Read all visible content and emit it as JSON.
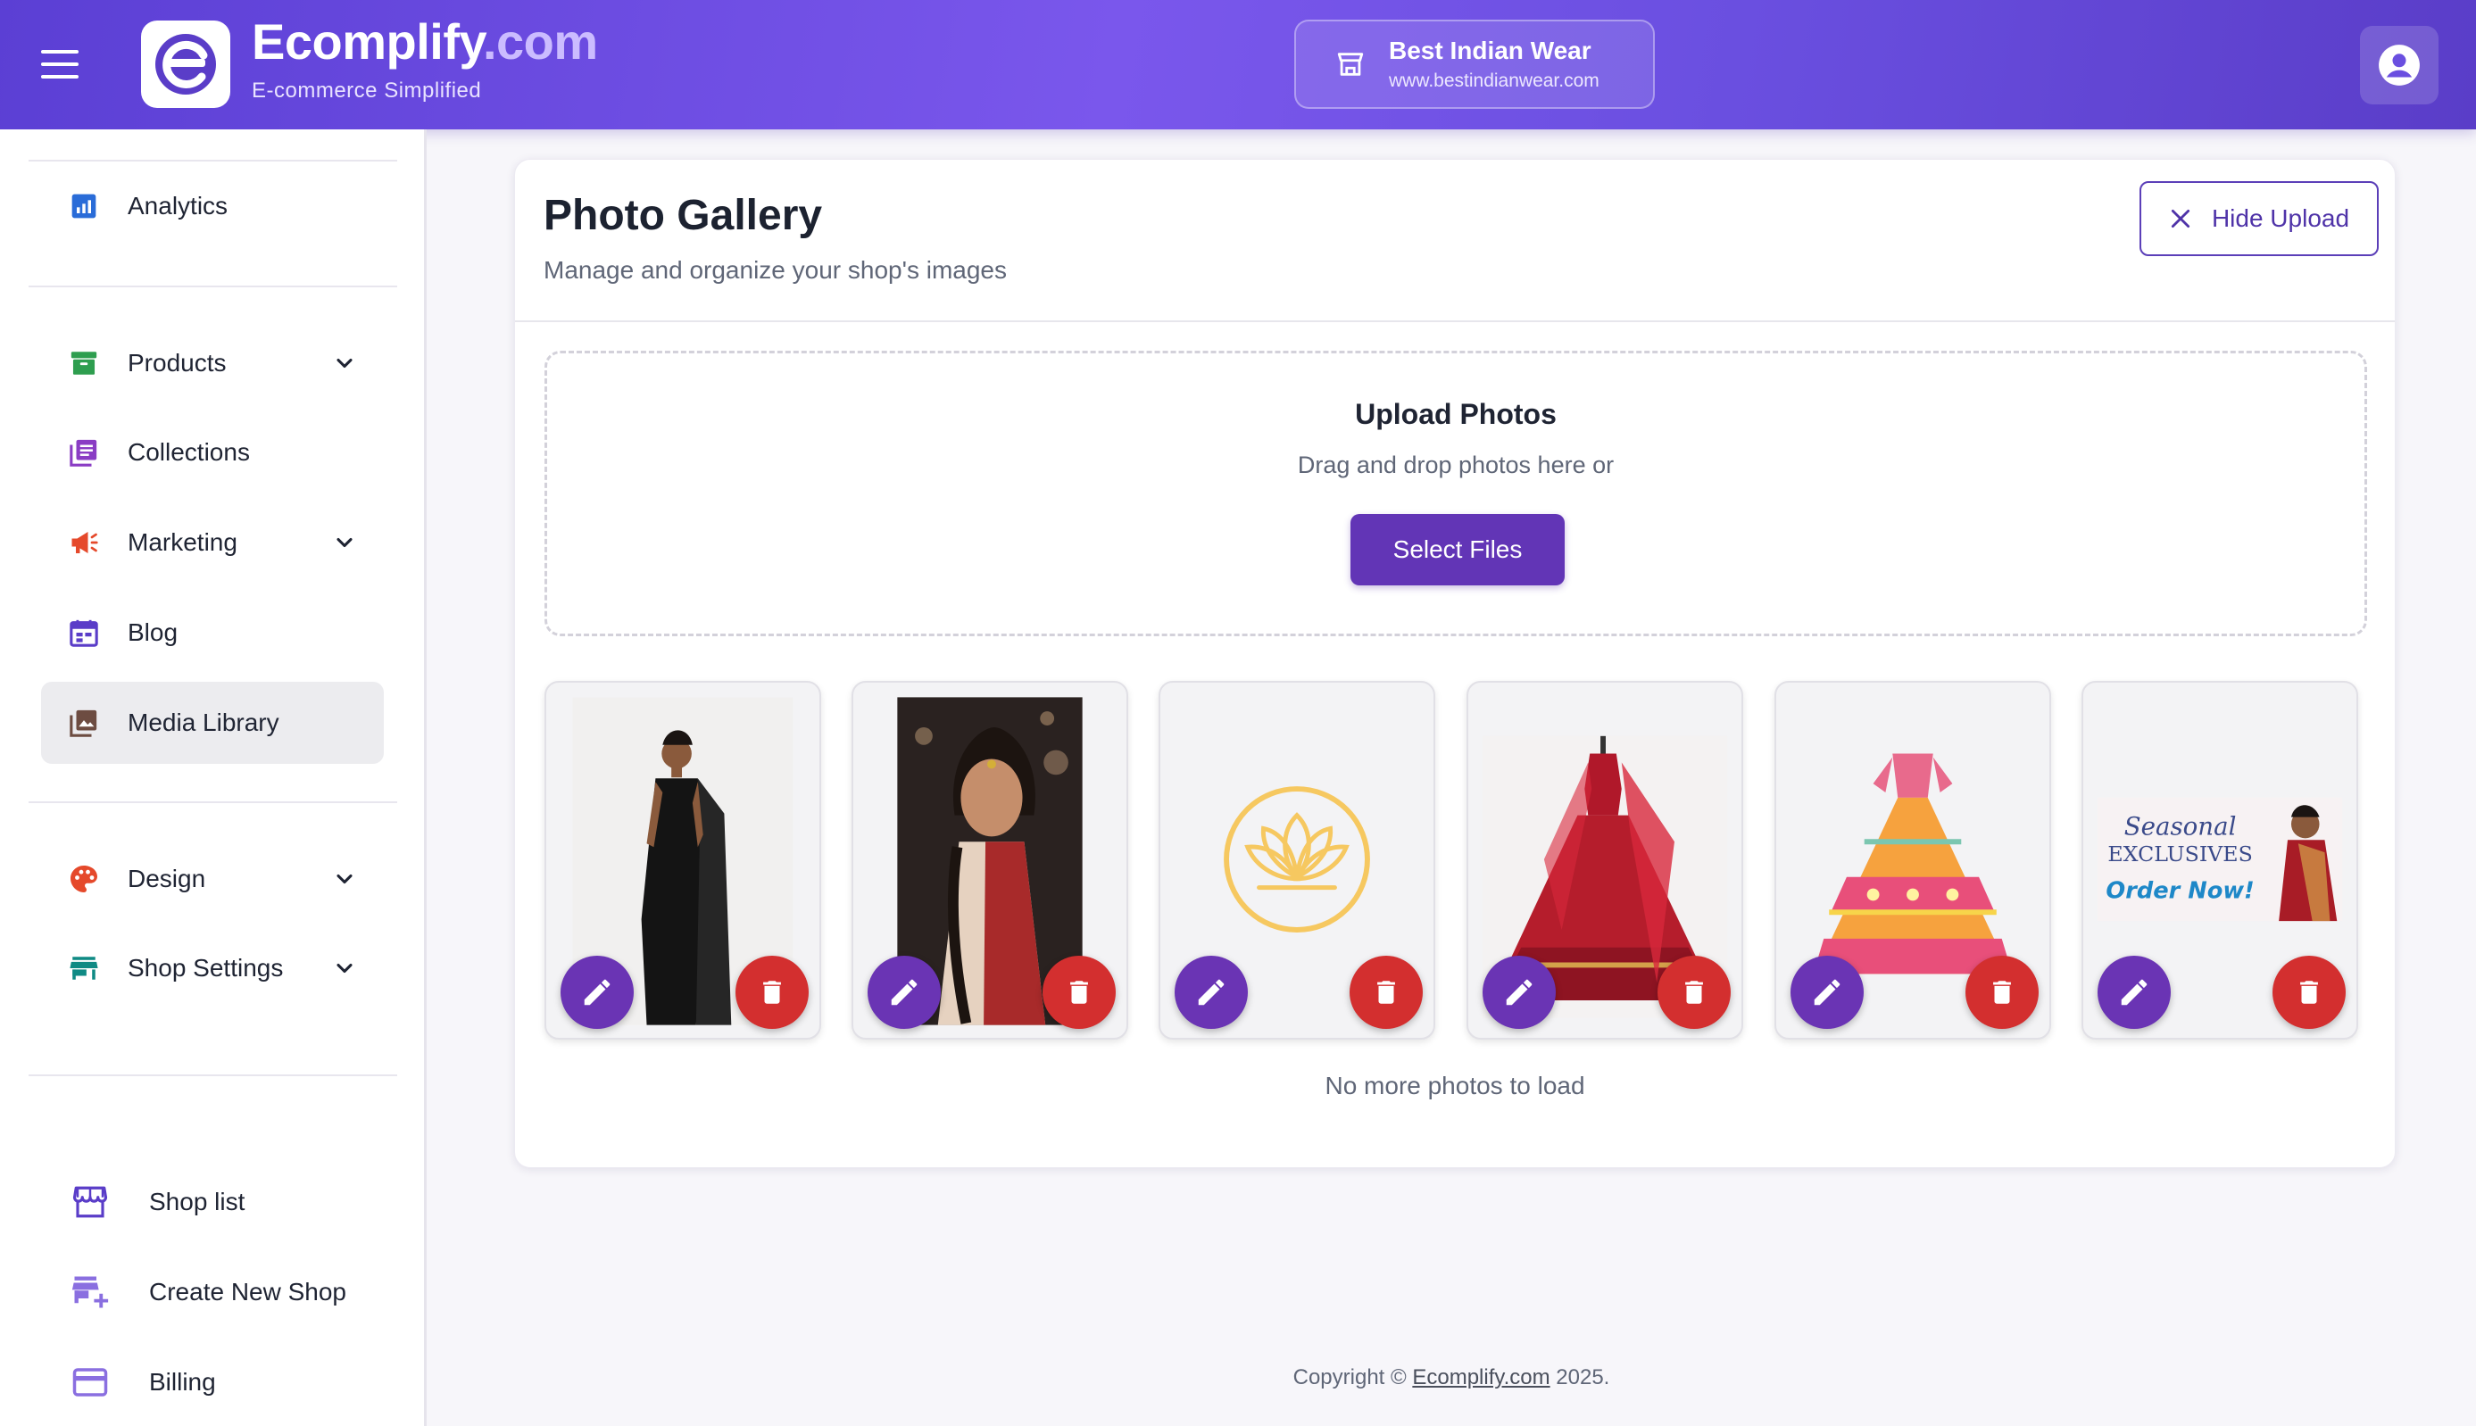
{
  "header": {
    "brand_name": "Ecomplify",
    "brand_tld": ".com",
    "brand_tagline": "E-commerce Simplified",
    "shop_name": "Best Indian Wear",
    "shop_url": "www.bestindianwear.com"
  },
  "sidebar": {
    "items": [
      {
        "label": "Analytics",
        "icon": "analytics-icon",
        "color": "#2a6cd8"
      },
      {
        "label": "Products",
        "icon": "archive-icon",
        "color": "#2e9e4f",
        "expandable": true
      },
      {
        "label": "Collections",
        "icon": "collections-icon",
        "color": "#8a3cc4"
      },
      {
        "label": "Marketing",
        "icon": "megaphone-icon",
        "color": "#e5492b",
        "expandable": true
      },
      {
        "label": "Blog",
        "icon": "calendar-icon",
        "color": "#5a3dc8"
      },
      {
        "label": "Media Library",
        "icon": "photo-library-icon",
        "color": "#6d4c41",
        "active": true
      },
      {
        "label": "Design",
        "icon": "palette-icon",
        "color": "#e5492b",
        "expandable": true
      },
      {
        "label": "Shop Settings",
        "icon": "store-icon",
        "color": "#0f8a84",
        "expandable": true
      }
    ],
    "bottom_items": [
      {
        "label": "Shop list",
        "icon": "storefront-icon"
      },
      {
        "label": "Create New Shop",
        "icon": "add-store-icon"
      },
      {
        "label": "Billing",
        "icon": "credit-card-icon"
      }
    ]
  },
  "gallery": {
    "title": "Photo Gallery",
    "subtitle": "Manage and organize your shop's images",
    "hide_upload_label": "Hide Upload",
    "upload_title": "Upload Photos",
    "upload_text": "Drag and drop photos here or",
    "select_files_label": "Select Files",
    "no_more_text": "No more photos to load",
    "photos": [
      {
        "name": "black-saree-photo"
      },
      {
        "name": "bride-portrait-photo"
      },
      {
        "name": "lotus-logo-photo"
      },
      {
        "name": "red-lehenga-photo"
      },
      {
        "name": "orange-lehenga-photo"
      },
      {
        "name": "seasonal-exclusives-banner-photo",
        "banner_line1": "Seasonal",
        "banner_line2": "EXCLUSIVES",
        "banner_cta": "Order Now!"
      }
    ]
  },
  "footer": {
    "prefix": "Copyright © ",
    "link": "Ecomplify.com",
    "suffix": " 2025."
  },
  "colors": {
    "header_gradient_start": "#5b3fd4",
    "header_gradient_end": "#7a57ec",
    "primary_button": "#6235b6",
    "edit_button": "#6a34b4",
    "delete_button": "#d32f2f"
  }
}
